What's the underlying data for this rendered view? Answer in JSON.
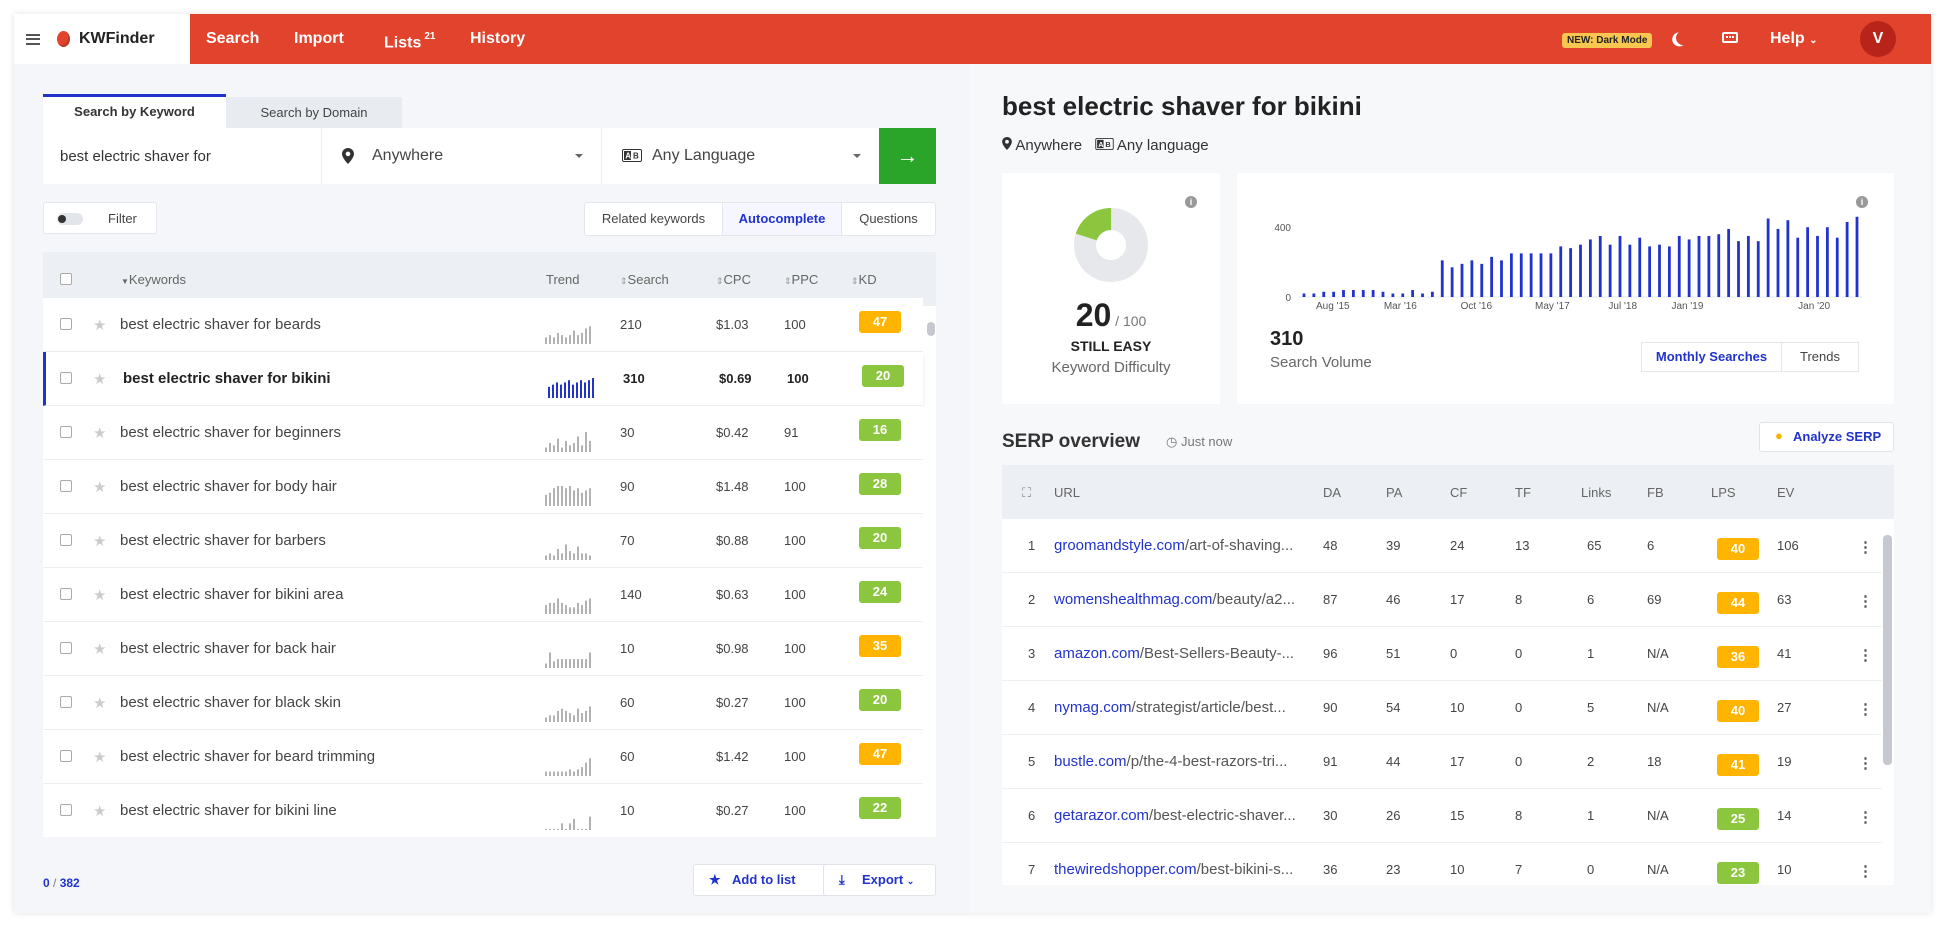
{
  "nav": {
    "brand": "KWFinder",
    "items": [
      {
        "label": "Search"
      },
      {
        "label": "Import"
      },
      {
        "label": "Lists",
        "badge": "21"
      },
      {
        "label": "History"
      }
    ],
    "new_badge": "NEW: Dark Mode",
    "help": "Help",
    "avatar": "V",
    "icons": [
      "menu-icon",
      "logo-icon",
      "moon-icon",
      "keyboard-icon",
      "chevron-down-icon"
    ]
  },
  "search": {
    "tab_keyword": "Search by Keyword",
    "tab_domain": "Search by Domain",
    "keyword_value": "best electric shaver for",
    "location": "Anywhere",
    "language": "Any Language",
    "go_icon": "arrow-right-icon"
  },
  "filter": {
    "label": "Filter"
  },
  "kw_tabs": [
    "Related keywords",
    "Autocomplete",
    "Questions"
  ],
  "kw_active_tab": "Autocomplete",
  "kw_table": {
    "headers": {
      "keywords": "Keywords",
      "trend": "Trend",
      "search": "Search",
      "cpc": "CPC",
      "ppc": "PPC",
      "kd": "KD"
    },
    "rows": [
      {
        "keyword": "best electric shaver for beards",
        "search": "210",
        "cpc": "$1.03",
        "ppc": "100",
        "kd": "47",
        "trend": [
          3,
          4,
          3,
          5,
          4,
          3,
          4,
          6,
          4,
          5,
          7,
          8
        ]
      },
      {
        "keyword": "best electric shaver for bikini",
        "search": "310",
        "cpc": "$0.69",
        "ppc": "100",
        "kd": "20",
        "selected": true,
        "trend": [
          5,
          6,
          7,
          6,
          7,
          8,
          6,
          7,
          8,
          7,
          8,
          9
        ]
      },
      {
        "keyword": "best electric shaver for beginners",
        "search": "30",
        "cpc": "$0.42",
        "ppc": "91",
        "kd": "16",
        "trend": [
          2,
          4,
          3,
          6,
          2,
          5,
          3,
          4,
          7,
          3,
          9,
          5
        ]
      },
      {
        "keyword": "best electric shaver for body hair",
        "search": "90",
        "cpc": "$1.48",
        "ppc": "100",
        "kd": "28",
        "trend": [
          5,
          6,
          8,
          9,
          9,
          8,
          9,
          7,
          8,
          6,
          7,
          8
        ]
      },
      {
        "keyword": "best electric shaver for barbers",
        "search": "70",
        "cpc": "$0.88",
        "ppc": "100",
        "kd": "20",
        "trend": [
          2,
          3,
          2,
          5,
          3,
          7,
          4,
          3,
          6,
          3,
          3,
          2
        ]
      },
      {
        "keyword": "best electric shaver for bikini area",
        "search": "140",
        "cpc": "$0.63",
        "ppc": "100",
        "kd": "24",
        "trend": [
          4,
          5,
          5,
          7,
          5,
          4,
          3,
          3,
          5,
          4,
          6,
          7
        ]
      },
      {
        "keyword": "best electric shaver for back hair",
        "search": "10",
        "cpc": "$0.98",
        "ppc": "100",
        "kd": "35",
        "trend": [
          2,
          7,
          3,
          4,
          4,
          4,
          4,
          4,
          4,
          4,
          4,
          7
        ]
      },
      {
        "keyword": "best electric shaver for black skin",
        "search": "60",
        "cpc": "$0.27",
        "ppc": "100",
        "kd": "20",
        "trend": [
          2,
          3,
          3,
          5,
          6,
          5,
          4,
          3,
          6,
          4,
          5,
          7
        ]
      },
      {
        "keyword": "best electric shaver for beard trimming",
        "search": "60",
        "cpc": "$1.42",
        "ppc": "100",
        "kd": "47",
        "trend": [
          2,
          2,
          2,
          2,
          2,
          2,
          3,
          2,
          3,
          4,
          6,
          8
        ]
      },
      {
        "keyword": "best electric shaver for bikini line",
        "search": "10",
        "cpc": "$0.27",
        "ppc": "100",
        "kd": "22",
        "trend": [
          0,
          0,
          0,
          0,
          3,
          0,
          3,
          5,
          0,
          0,
          0,
          6
        ]
      }
    ]
  },
  "footer": {
    "count_selected": "0",
    "count_total": "382",
    "add_to_list": "Add to list",
    "export": "Export"
  },
  "detail": {
    "keyword": "best electric shaver for bikini",
    "location": "Anywhere",
    "language": "Any language",
    "kd_value": "20",
    "kd_max": "/ 100",
    "kd_status": "STILL EASY",
    "kd_label": "Keyword Difficulty",
    "search_volume": "310",
    "search_volume_label": "Search Volume",
    "tab_monthly": "Monthly Searches",
    "tab_trends": "Trends"
  },
  "chart_data": {
    "type": "bar",
    "yticks": [
      "400",
      "0"
    ],
    "ylim": [
      0,
      470
    ],
    "xticks": [
      "Aug '15",
      "Mar '16",
      "Oct '16",
      "May '17",
      "Jul '18",
      "Jan '19",
      "Jan '20"
    ],
    "values": [
      20,
      20,
      30,
      30,
      40,
      40,
      40,
      40,
      30,
      20,
      20,
      40,
      20,
      30,
      210,
      170,
      190,
      210,
      190,
      230,
      210,
      250,
      250,
      250,
      250,
      250,
      290,
      280,
      300,
      330,
      350,
      300,
      350,
      300,
      340,
      290,
      300,
      290,
      350,
      330,
      350,
      350,
      360,
      390,
      320,
      350,
      320,
      450,
      390,
      440,
      340,
      400,
      350,
      400,
      340,
      430,
      460
    ]
  },
  "serp": {
    "title": "SERP overview",
    "time": "Just now",
    "analyze": "Analyze SERP",
    "headers": {
      "url": "URL",
      "da": "DA",
      "pa": "PA",
      "cf": "CF",
      "tf": "TF",
      "links": "Links",
      "fb": "FB",
      "lps": "LPS",
      "ev": "EV"
    },
    "rows": [
      {
        "rank": "1",
        "domain": "groomandstyle.com",
        "path": "/art-of-shaving...",
        "da": "48",
        "pa": "39",
        "cf": "24",
        "tf": "13",
        "links": "65",
        "fb": "6",
        "lps": "40",
        "ev": "106"
      },
      {
        "rank": "2",
        "domain": "womenshealthmag.com",
        "path": "/beauty/a2...",
        "da": "87",
        "pa": "46",
        "cf": "17",
        "tf": "8",
        "links": "6",
        "fb": "69",
        "lps": "44",
        "ev": "63"
      },
      {
        "rank": "3",
        "domain": "amazon.com",
        "path": "/Best-Sellers-Beauty-...",
        "da": "96",
        "pa": "51",
        "cf": "0",
        "tf": "0",
        "links": "1",
        "fb": "N/A",
        "lps": "36",
        "ev": "41"
      },
      {
        "rank": "4",
        "domain": "nymag.com",
        "path": "/strategist/article/best...",
        "da": "90",
        "pa": "54",
        "cf": "10",
        "tf": "0",
        "links": "5",
        "fb": "N/A",
        "lps": "40",
        "ev": "27"
      },
      {
        "rank": "5",
        "domain": "bustle.com",
        "path": "/p/the-4-best-razors-tri...",
        "da": "91",
        "pa": "44",
        "cf": "17",
        "tf": "0",
        "links": "2",
        "fb": "18",
        "lps": "41",
        "ev": "19"
      },
      {
        "rank": "6",
        "domain": "getarazor.com",
        "path": "/best-electric-shaver...",
        "da": "30",
        "pa": "26",
        "cf": "15",
        "tf": "8",
        "links": "1",
        "fb": "N/A",
        "lps": "25",
        "ev": "14"
      },
      {
        "rank": "7",
        "domain": "thewiredshopper.com",
        "path": "/best-bikini-s...",
        "da": "36",
        "pa": "23",
        "cf": "10",
        "tf": "7",
        "links": "0",
        "fb": "N/A",
        "lps": "23",
        "ev": "10"
      }
    ]
  },
  "colors": {
    "brand": "#e2432d",
    "accent": "#2233cc",
    "go": "#2aa52a",
    "kd_orange": "#ffb400",
    "kd_green": "#8cc63f"
  }
}
